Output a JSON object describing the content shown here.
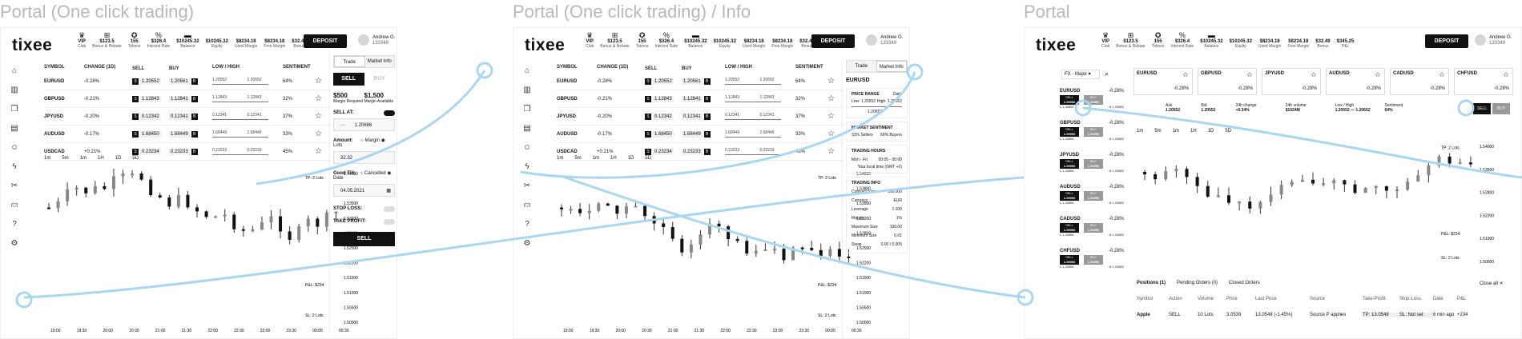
{
  "panels": [
    {
      "title": "Portal (One click trading)",
      "logo": "tixee",
      "topbar": [
        {
          "icon": "crown-icon",
          "glyph": "♛",
          "value": "VIP",
          "label": "Club"
        },
        {
          "icon": "gift-icon",
          "glyph": "⊞",
          "value": "$123.5",
          "label": "Bonus & Rebate"
        },
        {
          "icon": "token-icon",
          "glyph": "✪",
          "value": "155",
          "label": "Tokens"
        },
        {
          "icon": "percent-icon",
          "glyph": "%",
          "value": "$326.4",
          "label": "Interest Rate"
        },
        {
          "icon": "balance-icon",
          "glyph": "▬",
          "value": "$10245.32",
          "label": "Balance"
        },
        {
          "icon": "equity-icon",
          "glyph": " ",
          "value": "$10245.32",
          "label": "Equity"
        },
        {
          "icon": "margin-icon",
          "glyph": " ",
          "value": "$8234.18",
          "label": "Used Margin"
        },
        {
          "icon": "free-icon",
          "glyph": " ",
          "value": "$8234.18",
          "label": "Free Margin"
        },
        {
          "icon": "bonus-icon",
          "glyph": " ",
          "value": "$32.49",
          "label": "Bonus"
        },
        {
          "icon": "pl-icon",
          "glyph": " ",
          "value": "$345.25",
          "label": "P&L"
        }
      ],
      "deposit": "DEPOSIT",
      "user_name": "Andrew G.",
      "user_id": "133349"
    },
    {
      "title": "Portal (One click trading) / Info",
      "logo": "tixee",
      "deposit": "DEPOSIT",
      "user_name": "Andrew G.",
      "user_id": "133349"
    },
    {
      "title": "Portal",
      "logo": "tixee",
      "deposit": "DEPOSIT",
      "user_name": "Andrew G.",
      "user_id": "133349"
    }
  ],
  "watch_headers": [
    "SYMBOL",
    "CHANGE (1D)",
    "SELL",
    "BUY",
    "LOW / HIGH",
    "SENTIMENT"
  ],
  "watch_rows": [
    {
      "symbol": "EURUSD",
      "change": "-0.28%",
      "sell": "1.20552",
      "buy": "1.20561",
      "low": "1.20552",
      "high": "1.20652",
      "sent": "64%"
    },
    {
      "symbol": "GBPUSD",
      "change": "-0.21%",
      "sell": "1.12843",
      "buy": "1.12841",
      "low": "1.12843",
      "high": "1.12843",
      "sent": "32%"
    },
    {
      "symbol": "JPYUSD",
      "change": "-0.20%",
      "sell": "0.12342",
      "buy": "0.12341",
      "low": "0.12341",
      "high": "0.12341",
      "sent": "37%"
    },
    {
      "symbol": "AUDUSD",
      "change": "-0.17%",
      "sell": "1.68450",
      "buy": "1.68449",
      "low": "1.68449",
      "high": "1.68449",
      "sent": "33%"
    },
    {
      "symbol": "USDCAD",
      "change": "+0.21%",
      "sell": "0.23234",
      "buy": "0.23233",
      "low": "0.23233",
      "high": "0.23233",
      "sent": "45%"
    }
  ],
  "timeframes": [
    "1m",
    "5m",
    "1m",
    "1H",
    "1D",
    "5D"
  ],
  "price_ticks": [
    "1.54000",
    "1.53800",
    "1.53500",
    "1.53200",
    "1.52800",
    "1.52500",
    "1.52200",
    "1.51500",
    "1.51000",
    "1.50500",
    "1.50000"
  ],
  "time_ticks": [
    "19:00",
    "19:30",
    "20:00",
    "20:30",
    "21:00",
    "21:30",
    "22:00",
    "22:30",
    "23:00",
    "23:30",
    "00:00",
    "00:30"
  ],
  "chart_tags": {
    "tp": "TP: 2 Lots",
    "sl": "SL: 2 Lots",
    "pl": "P&L: $234"
  },
  "trade_panel": {
    "tab_trade": "Trade",
    "tab_info": "Market Info",
    "sell": "SELL",
    "buy": "BUY",
    "margin_req_val": "$500",
    "margin_req_lbl": "Margin Required",
    "margin_av_val": "$1,500",
    "margin_av_lbl": "Margin Available",
    "sell_at": "SELL AT:",
    "sell_at_val": "1.20686",
    "amount": "Amount:",
    "opt_margin": "Margin",
    "opt_lots": "Lots",
    "amount_val": "32.32",
    "good_till": "Good Till:",
    "opt_cancel": "Cancelled",
    "opt_date": "Date",
    "date_val": "04.05.2021",
    "stop_loss": "STOP LOSS:",
    "take_profit": "TAKE PROFIT:",
    "sell_btn": "SELL"
  },
  "info_panel": {
    "symbol": "EURUSD",
    "price_range": "PRICE RANGE",
    "daily": "Daily",
    "low": "Low: 1.20552",
    "high": "High: 1.20652",
    "cur": "1.20552",
    "sentiment": "MARKET SENTIMENT",
    "sellers": "31% Sellers",
    "buyers": "69% Buyers",
    "hours": "TRADING HOURS",
    "days": "Mon - Fri",
    "time": "00:05 - 00:00",
    "local": "Your local time (GMT +2)",
    "tinfo": "TRADING INFO",
    "rows": [
      [
        "Contract Size",
        "100,000"
      ],
      [
        "Currency",
        "EUR"
      ],
      [
        "Leverage",
        "1:100"
      ],
      [
        "Margin",
        "1%"
      ],
      [
        "Maximum Size",
        "100.00"
      ],
      [
        "Minimum Size",
        "0.01"
      ],
      [
        "Swap",
        "0.00 / 0.005"
      ]
    ]
  },
  "portal": {
    "filter": "FX - Major",
    "list": [
      {
        "symbol": "EURUSD",
        "change": "-0.28%",
        "sell": "1.20552",
        "buy": "1.20552",
        "low": "L 1.20552",
        "high": "H 1.20652"
      },
      {
        "symbol": "GBPUSD",
        "change": "-0.28%",
        "sell": "1.20552",
        "buy": "1.20552",
        "low": "L 1.20552",
        "high": "H 1.20652"
      },
      {
        "symbol": "JPYUSD",
        "change": "-0.28%",
        "sell": "1.20552",
        "buy": "1.20552",
        "low": "L 1.20552",
        "high": "H 1.20652"
      },
      {
        "symbol": "AUDUSD",
        "change": "-0.28%",
        "sell": "1.20552",
        "buy": "1.20552",
        "low": "L 1.20552",
        "high": "H 1.20652"
      },
      {
        "symbol": "CADUSD",
        "change": "-0.28%",
        "sell": "1.20552",
        "buy": "1.20552",
        "low": "L 1.20552",
        "high": "H 1.20652"
      },
      {
        "symbol": "CHFUSD",
        "change": "-0.28%",
        "sell": "1.20552",
        "buy": "1.20552",
        "low": "L 1.20552",
        "high": "H 1.20652"
      }
    ],
    "cards": [
      {
        "symbol": "EURUSD",
        "pct": "-0.28%"
      },
      {
        "symbol": "GBPUSD",
        "pct": "-0.28%"
      },
      {
        "symbol": "JPYUSD",
        "pct": "-0.28%"
      },
      {
        "symbol": "AUDUSD",
        "pct": "-0.28%"
      },
      {
        "symbol": "CADUSD",
        "pct": "-0.28%"
      },
      {
        "symbol": "CHFUSD",
        "pct": "-0.28%"
      }
    ],
    "stats": [
      [
        "Ask",
        "1.20552"
      ],
      [
        "Bid",
        "1.20552"
      ],
      [
        "24h change",
        "+0.34%"
      ],
      [
        "24h volume",
        "$1024M"
      ],
      [
        "Low / High",
        "1.20552 — 1.20652"
      ],
      [
        "Sentiment",
        "64%"
      ]
    ],
    "sell": "SELL",
    "buy": "BUY",
    "pos_tabs": [
      "Positions (1)",
      "Pending Orders (0)",
      "Closed Orders"
    ],
    "close_all": "Close all",
    "pos_headers": [
      "Symbol",
      "Action",
      "Volume",
      "Price",
      "Last Price",
      "Source",
      "Take-Profit",
      "Stop-Loss",
      "Date",
      "P&L"
    ],
    "pos_row": [
      "Apple",
      "SELL",
      "10 Lots",
      "3.0539",
      "13.0548 (-1.45%)",
      "Source P applies",
      "TP: 13.0548",
      "SL: Not set",
      "6 min ago",
      "+234"
    ]
  }
}
